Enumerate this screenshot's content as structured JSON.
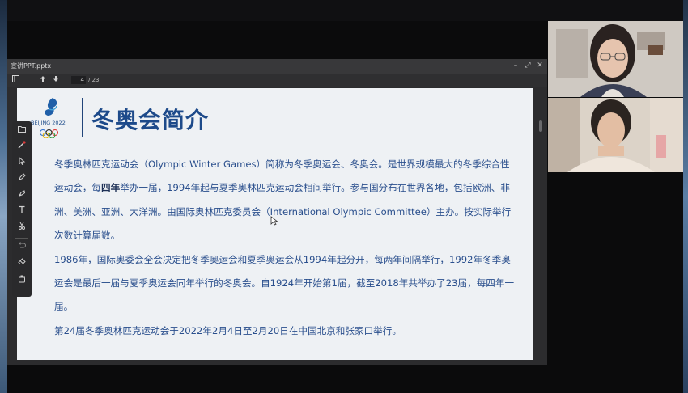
{
  "window": {
    "title": "宣讲PPT.pptx",
    "controls": {
      "minimize": "–",
      "restore": "⤢",
      "close": "✕"
    }
  },
  "toolbar": {
    "sidebar_icon": "sidebar-toggle-icon",
    "prev_icon": "arrow-up-icon",
    "next_icon": "arrow-down-icon",
    "page_current": "4",
    "page_total": "/ 23"
  },
  "slide": {
    "logo_text": "BEIJING 2022",
    "title": "冬奥会简介",
    "paragraphs": [
      {
        "before": "冬季奥林匹克运动会（Olympic Winter Games）简称为冬季奥运会、冬奥会。是世界规模最大的冬季综合性运动会，每",
        "bold": "四年",
        "after": "举办一届，1994年起与夏季奥林匹克运动会相间举行。参与国分布在世界各地，包括欧洲、非洲、美洲、亚洲、大洋洲。由国际奥林匹克委员会（International Olympic Committee）主办。按实际举行次数计算届数。"
      },
      {
        "text": "1986年，国际奥委会全会决定把冬季奥运会和夏季奥运会从1994年起分开，每两年间隔举行，1992年冬季奥运会是最后一届与夏季奥运会同年举行的冬奥会。自1924年开始第1届，截至2018年共举办了23届，每四年一届。"
      },
      {
        "text": "第24届冬季奥林匹克运动会于2022年2月4日至2月20日在中国北京和张家口举行。"
      }
    ]
  },
  "annotation_tools": [
    "folder-icon",
    "laser-pointer-icon",
    "select-arrow-icon",
    "pen-icon",
    "highlighter-icon",
    "text-icon",
    "scissors-icon",
    "undo-icon",
    "eraser-icon",
    "clear-icon"
  ],
  "colors": {
    "title_blue": "#1d4a8a",
    "body_blue": "#2a4f8d",
    "slide_bg": "#eef1f4",
    "window_bg": "#2c2c2e"
  },
  "participants": [
    {
      "tile": "participant-video-1"
    },
    {
      "tile": "participant-video-2"
    }
  ]
}
